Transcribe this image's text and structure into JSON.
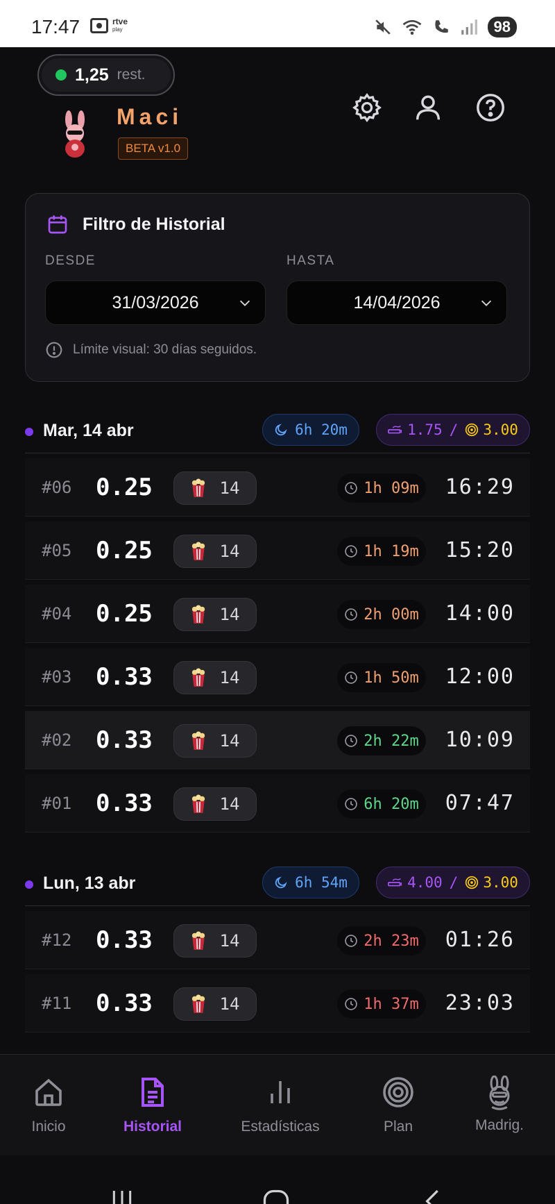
{
  "status_bar": {
    "time": "17:47",
    "app_badge_top": "rtve",
    "app_badge_bottom": "play",
    "battery": "98"
  },
  "header": {
    "credit_value": "1,25",
    "credit_suffix": "rest.",
    "brand_name": "Maci",
    "version": "BETA v1.0",
    "icons": [
      "gear-icon",
      "user-icon",
      "help-icon"
    ]
  },
  "filter": {
    "title": "Filtro de Historial",
    "from_label": "DESDE",
    "to_label": "HASTA",
    "from_value": "31/03/2026",
    "to_value": "14/04/2026",
    "note": "Límite visual: 30 días seguidos."
  },
  "days": [
    {
      "title": "Mar, 14 abr",
      "sleep": "6h 20m",
      "used": "1.75",
      "target": "3.00",
      "entries": [
        {
          "num": "#06",
          "dose": "0.25",
          "count": "14",
          "interval": "1h 09m",
          "time": "16:29",
          "tone": "orange"
        },
        {
          "num": "#05",
          "dose": "0.25",
          "count": "14",
          "interval": "1h 19m",
          "time": "15:20",
          "tone": "orange"
        },
        {
          "num": "#04",
          "dose": "0.25",
          "count": "14",
          "interval": "2h 00m",
          "time": "14:00",
          "tone": "orange"
        },
        {
          "num": "#03",
          "dose": "0.33",
          "count": "14",
          "interval": "1h 50m",
          "time": "12:00",
          "tone": "orange"
        },
        {
          "num": "#02",
          "dose": "0.33",
          "count": "14",
          "interval": "2h 22m",
          "time": "10:09",
          "tone": "green"
        },
        {
          "num": "#01",
          "dose": "0.33",
          "count": "14",
          "interval": "6h 20m",
          "time": "07:47",
          "tone": "green"
        }
      ]
    },
    {
      "title": "Lun, 13 abr",
      "sleep": "6h 54m",
      "used": "4.00",
      "target": "3.00",
      "entries": [
        {
          "num": "#12",
          "dose": "0.33",
          "count": "14",
          "interval": "2h 23m",
          "time": "01:26",
          "tone": "red"
        },
        {
          "num": "#11",
          "dose": "0.33",
          "count": "14",
          "interval": "1h 37m",
          "time": "23:03",
          "tone": "red"
        }
      ]
    }
  ],
  "nav": [
    {
      "label": "Inicio",
      "icon": "home-icon"
    },
    {
      "label": "Historial",
      "icon": "document-icon",
      "active": true
    },
    {
      "label": "Estadísticas",
      "icon": "bars-icon"
    },
    {
      "label": "Plan",
      "icon": "target-icon"
    },
    {
      "label": "Madrig.",
      "icon": "rabbit-icon"
    }
  ],
  "colors": {
    "accent": "#a855f7",
    "sleep": "#60a5fa",
    "target": "#facc15",
    "ok": "#5ed68a",
    "warn": "#f0a070",
    "over": "#ef6b6b"
  }
}
